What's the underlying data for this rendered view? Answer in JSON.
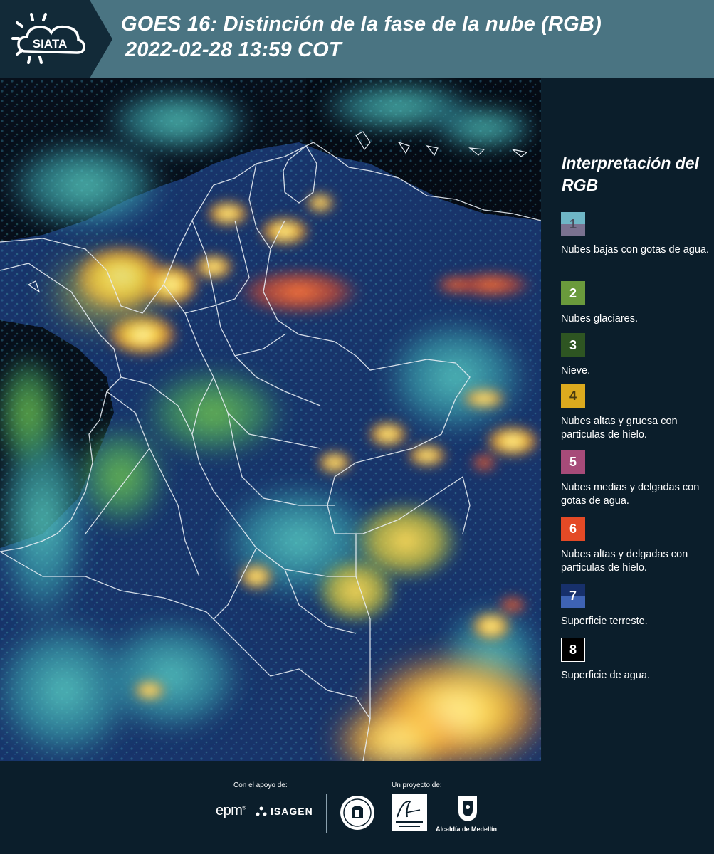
{
  "header": {
    "logo_text": "SIATA",
    "title_line1": "GOES 16: Distinción de la fase de la nube (RGB)",
    "title_line2": "2022-02-28 13:59 COT"
  },
  "map": {
    "alt": "Imagen satelital GOES 16 RGB de fase de nube sobre Colombia"
  },
  "legend": {
    "title": "Interpretación del RGB",
    "items": [
      {
        "number": "1",
        "label": "Nubes bajas con gotas de agua.",
        "color_top": "#6fb6c6",
        "color_bottom": "#7a7290"
      },
      {
        "number": "2",
        "label": "Nubes glaciares.",
        "color": "#6a9a3c"
      },
      {
        "number": "3",
        "label": "Nieve.",
        "color": "#2e5522"
      },
      {
        "number": "4",
        "label": "Nubes altas y gruesa con particulas de hielo.",
        "color": "#dcaa1e"
      },
      {
        "number": "5",
        "label": "Nubes medias y delgadas con gotas de agua.",
        "color": "#a74b79"
      },
      {
        "number": "6",
        "label": "Nubes altas y delgadas con particulas de hielo.",
        "color": "#e44a26"
      },
      {
        "number": "7",
        "label": "Superficie terreste.",
        "color_top": "#17306b",
        "color_bottom": "#3e63b4"
      },
      {
        "number": "8",
        "label": "Superficie de agua.",
        "color": "#000000"
      }
    ]
  },
  "footer": {
    "support_label": "Con el apoyo de:",
    "project_label": "Un proyecto de:",
    "epm": "epm",
    "isagen": "ISAGEN",
    "alcaldia": "Alcaldía de Medellín"
  }
}
